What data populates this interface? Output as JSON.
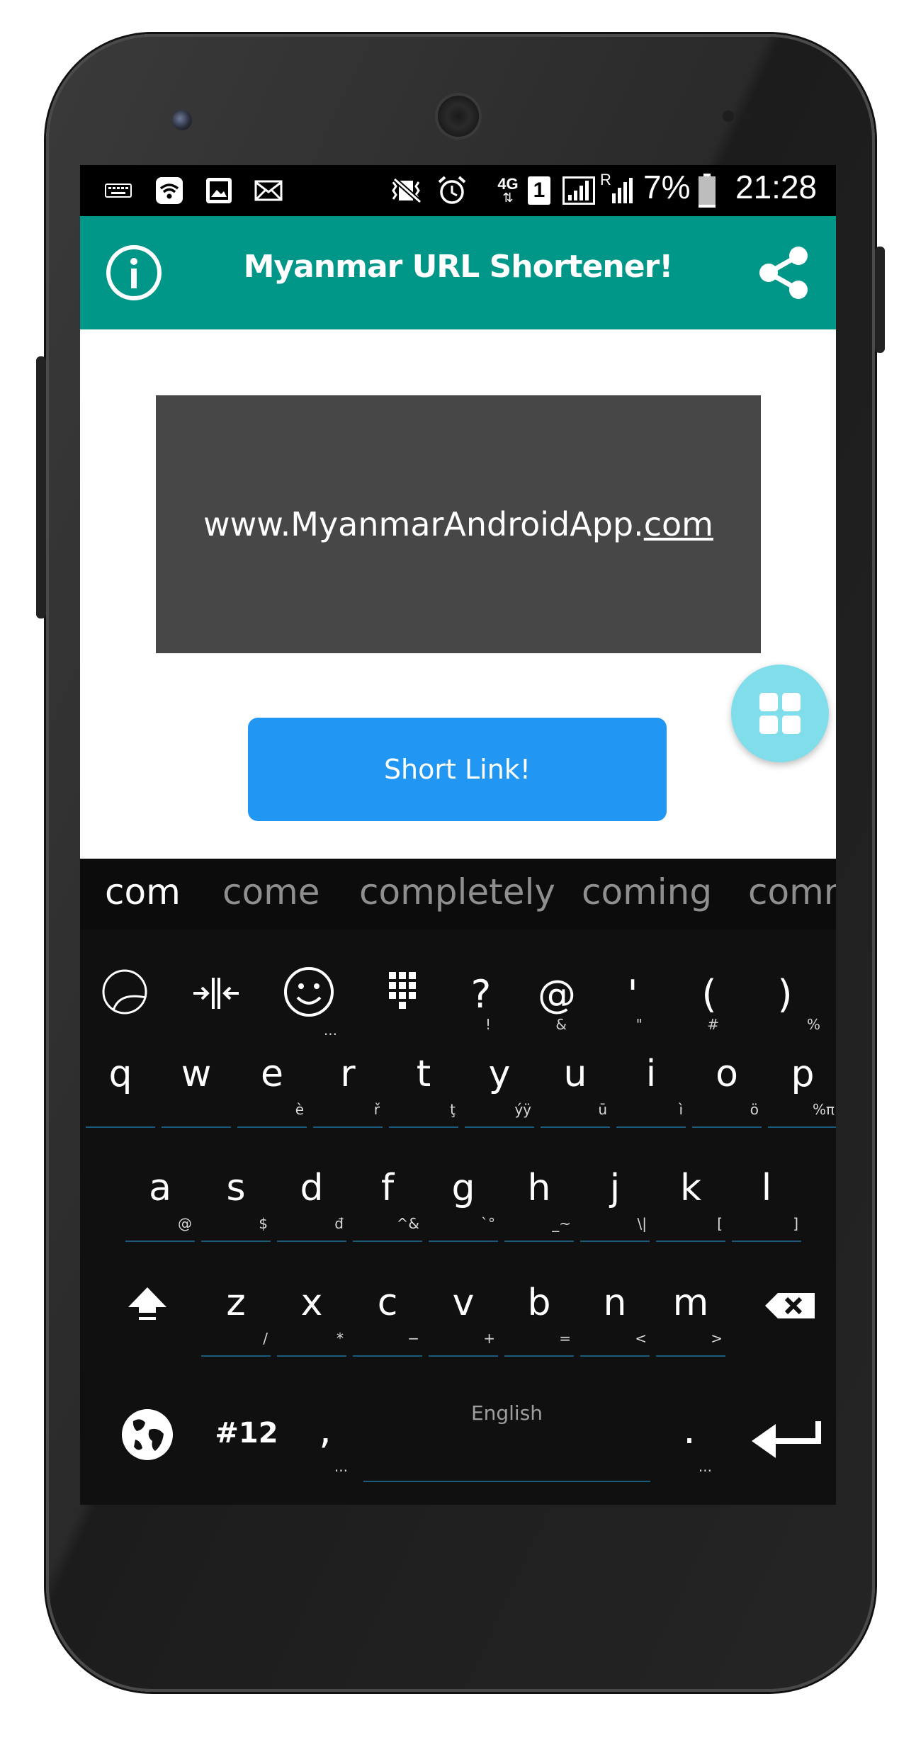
{
  "status_bar": {
    "icons": [
      "keyboard-icon",
      "wifi-icon",
      "image-icon",
      "mail-icon",
      "vibrate-off-icon",
      "alarm-icon",
      "4g-icon",
      "sim-1-icon",
      "signal-icon",
      "roaming-signal-icon"
    ],
    "roaming_label": "R",
    "network_label": "4G",
    "sim_label": "1",
    "battery": "7%",
    "time": "21:28"
  },
  "app_bar": {
    "title": "Myanmar URL Shortener!",
    "left_icon": "info-icon",
    "right_icon": "share-icon",
    "color": "#009688"
  },
  "main": {
    "url_prefix": "www.MyanmarAndroidApp.",
    "url_tld": "com",
    "button_label": "Short Link!",
    "button_color": "#2196f3",
    "fab_icon": "grid-icon",
    "fab_color": "#80deea"
  },
  "keyboard": {
    "suggestions": [
      "com",
      "come",
      "completely",
      "coming",
      "comm"
    ],
    "symbol_row": [
      {
        "main": "?",
        "sub": "!"
      },
      {
        "main": "@",
        "sub": "&"
      },
      {
        "main": "'",
        "sub": "\""
      },
      {
        "main": "(",
        "sub": "#"
      },
      {
        "main": ")",
        "sub": "%"
      }
    ],
    "tool_icons": [
      "sticker-icon",
      "cursor-move-icon",
      "emoji-icon",
      "numpad-icon"
    ],
    "emoji_sub": "...",
    "row1": [
      {
        "main": "q",
        "sub": ""
      },
      {
        "main": "w",
        "sub": ""
      },
      {
        "main": "e",
        "sub": "è"
      },
      {
        "main": "r",
        "sub": "ř"
      },
      {
        "main": "t",
        "sub": "ţ"
      },
      {
        "main": "y",
        "sub": "ýÿ"
      },
      {
        "main": "u",
        "sub": "ū"
      },
      {
        "main": "i",
        "sub": "ì"
      },
      {
        "main": "o",
        "sub": "ö"
      },
      {
        "main": "p",
        "sub": "%π"
      }
    ],
    "row2": [
      {
        "main": "a",
        "sub": "@"
      },
      {
        "main": "s",
        "sub": "$"
      },
      {
        "main": "d",
        "sub": "đ"
      },
      {
        "main": "f",
        "sub": "^&"
      },
      {
        "main": "g",
        "sub": "`°"
      },
      {
        "main": "h",
        "sub": "_~"
      },
      {
        "main": "j",
        "sub": "\\|"
      },
      {
        "main": "k",
        "sub": "["
      },
      {
        "main": "l",
        "sub": "]"
      }
    ],
    "row3": [
      {
        "main": "z",
        "sub": "/"
      },
      {
        "main": "x",
        "sub": "*"
      },
      {
        "main": "c",
        "sub": "−"
      },
      {
        "main": "v",
        "sub": "+"
      },
      {
        "main": "b",
        "sub": "="
      },
      {
        "main": "n",
        "sub": "<"
      },
      {
        "main": "m",
        "sub": ">"
      }
    ],
    "shift_icon": "shift-icon",
    "backspace_icon": "backspace-icon",
    "globe_icon": "globe-icon",
    "numbers_label": "#12",
    "comma_label": ",",
    "comma_sub": "...",
    "space_label": "English",
    "period_label": ".",
    "period_sub": "...",
    "enter_icon": "enter-icon"
  }
}
